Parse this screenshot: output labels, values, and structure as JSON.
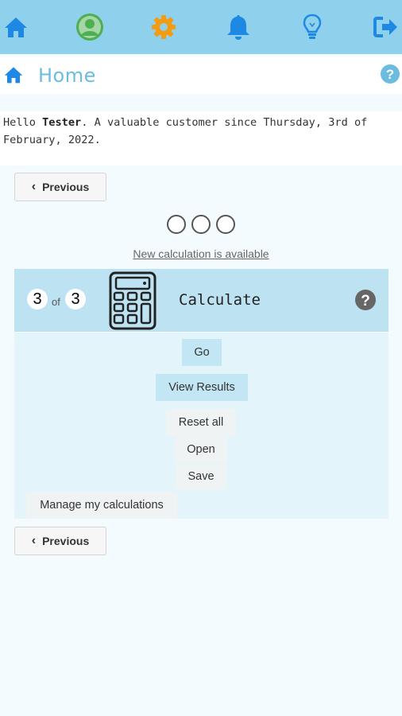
{
  "nav": {
    "items": [
      {
        "icon": "home-icon",
        "label": "Home"
      },
      {
        "icon": "user-avatar-icon",
        "label": "Profile"
      },
      {
        "icon": "gear-icon",
        "label": "Settings"
      },
      {
        "icon": "bell-icon",
        "label": "Notifications"
      },
      {
        "icon": "lightbulb-icon",
        "label": "Tips"
      },
      {
        "icon": "logout-icon",
        "label": "Logout"
      }
    ],
    "colors": {
      "bar": "#8fd0ec",
      "icon_blue": "#1e88e5",
      "avatar_green": "#4caf50",
      "gear_orange": "#f39c12"
    }
  },
  "header": {
    "title": "Home",
    "title_color": "#6bbde0"
  },
  "greeting": {
    "prefix": "Hello ",
    "name": "Tester",
    "suffix": ". A valuable customer since Thursday, 3rd of February, 2022."
  },
  "pager": {
    "previous_label": "Previous",
    "total_dots": 3
  },
  "new_calc_link": "New calculation is available",
  "card": {
    "current_step": "3",
    "of_label": "of",
    "total_steps": "3",
    "title": "Calculate",
    "icon": "calculator-icon",
    "header_color": "#bde3f3",
    "body_color": "#e4f4fb"
  },
  "actions": {
    "go": "Go",
    "view_results": "View Results",
    "reset_all": "Reset all",
    "open": "Open",
    "save": "Save",
    "manage": "Manage my calculations"
  }
}
